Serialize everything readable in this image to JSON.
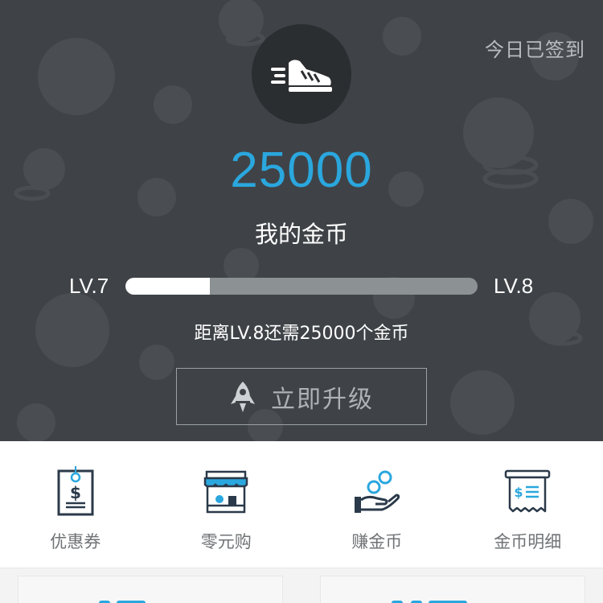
{
  "header": {
    "signin_status": "今日已签到",
    "avatar_icon": "sneaker-icon",
    "coins": "25000",
    "coins_label": "我的金币",
    "level_current": "LV.7",
    "level_next": "LV.8",
    "progress_fraction": 0.24,
    "remaining_text": "距离LV.8还需25000个金币",
    "upgrade_label": "立即升级",
    "upgrade_icon": "rocket-icon"
  },
  "menu": {
    "items": [
      {
        "label": "优惠券",
        "icon": "coupon-icon"
      },
      {
        "label": "零元购",
        "icon": "shop-icon"
      },
      {
        "label": "赚金币",
        "icon": "earn-coins-icon"
      },
      {
        "label": "金币明细",
        "icon": "receipt-icon"
      }
    ]
  },
  "colors": {
    "header_bg": "#3f4347",
    "accent": "#2aa7de",
    "icon_dark": "#2b3a4a"
  }
}
